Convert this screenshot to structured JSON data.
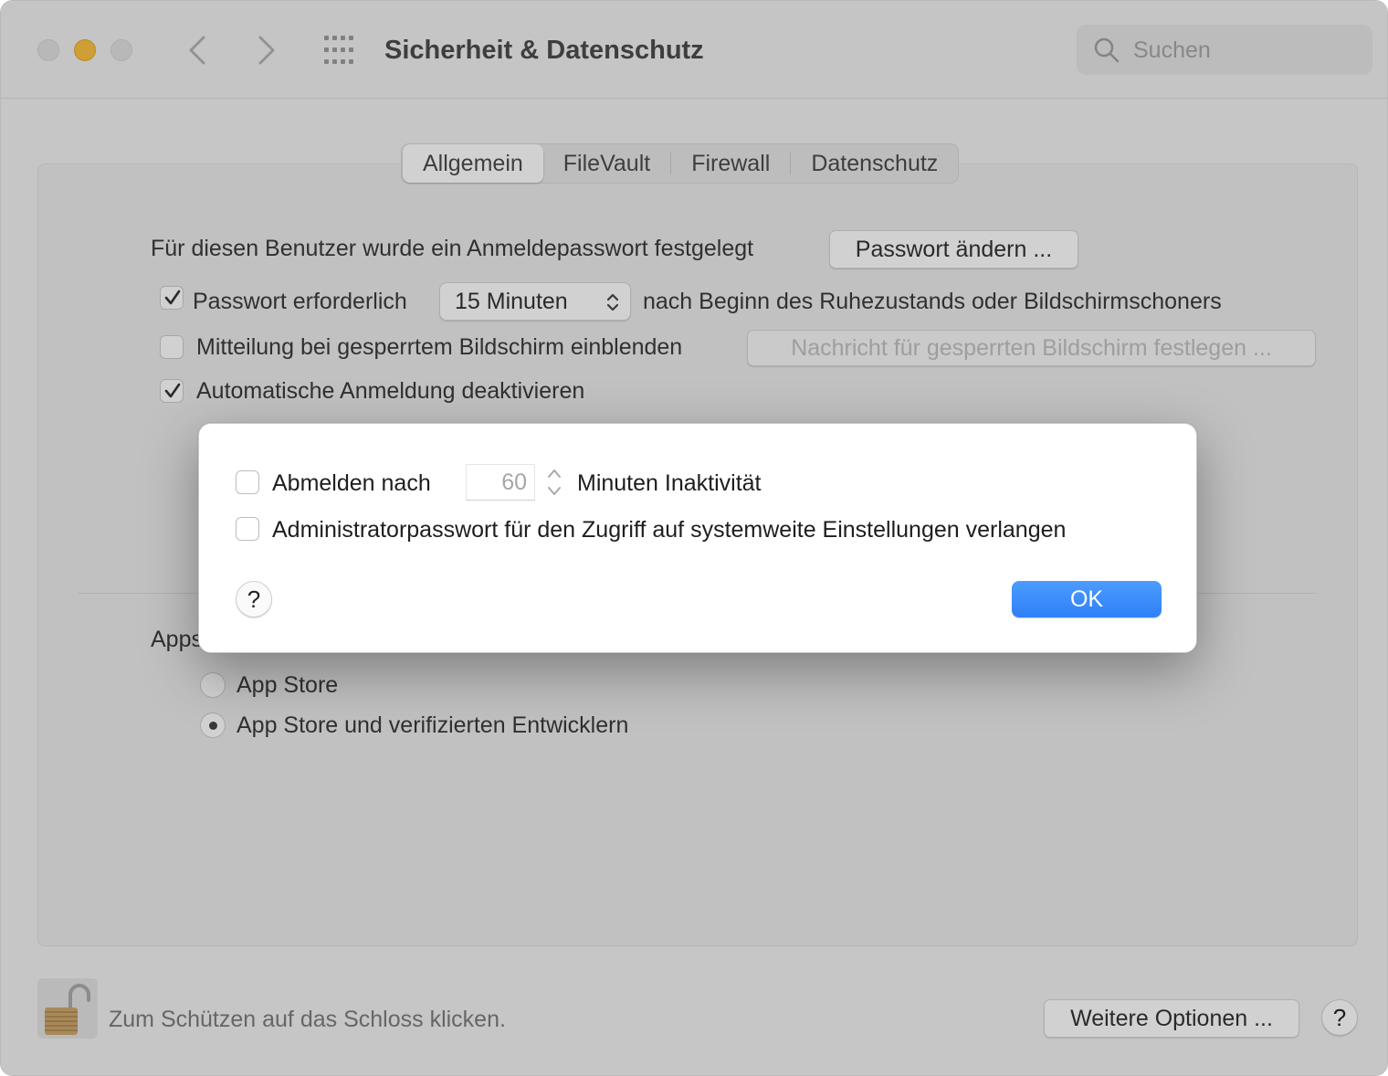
{
  "window": {
    "title": "Sicherheit & Datenschutz"
  },
  "search": {
    "placeholder": "Suchen"
  },
  "tabs": [
    {
      "label": "Allgemein",
      "active": true
    },
    {
      "label": "FileVault",
      "active": false
    },
    {
      "label": "Firewall",
      "active": false
    },
    {
      "label": "Datenschutz",
      "active": false
    }
  ],
  "general": {
    "password_set_text": "Für diesen Benutzer wurde ein Anmeldepasswort festgelegt",
    "change_password_button": "Passwort ändern ...",
    "require_password_label": "Passwort erforderlich",
    "require_password_checked": true,
    "require_password_delay": "15 Minuten",
    "require_password_suffix": "nach Beginn des Ruhezustands oder Bildschirmschoners",
    "lock_message_label": "Mitteilung bei gesperrtem Bildschirm einblenden",
    "lock_message_checked": false,
    "lock_message_button": "Nachricht für gesperrten Bildschirm festlegen ...",
    "auto_login_label": "Automatische Anmeldung deaktivieren",
    "auto_login_checked": true
  },
  "apps": {
    "label": "Apps",
    "options": [
      {
        "label": "App Store",
        "selected": false
      },
      {
        "label": "App Store und verifizierten Entwicklern",
        "selected": true
      }
    ]
  },
  "footer": {
    "lock_text": "Zum Schützen auf das Schloss klicken.",
    "more_options_button": "Weitere Optionen ...",
    "help": "?"
  },
  "sheet": {
    "logout_label": "Abmelden nach",
    "logout_checked": false,
    "logout_minutes": "60",
    "logout_suffix": "Minuten Inaktivität",
    "admin_password_label": "Administratorpasswort für den Zugriff auf systemweite Einstellungen verlangen",
    "admin_password_checked": false,
    "help": "?",
    "ok_button": "OK"
  },
  "colors": {
    "accent": "#2f80f7",
    "traffic_minimize": "#f7bd3f"
  }
}
